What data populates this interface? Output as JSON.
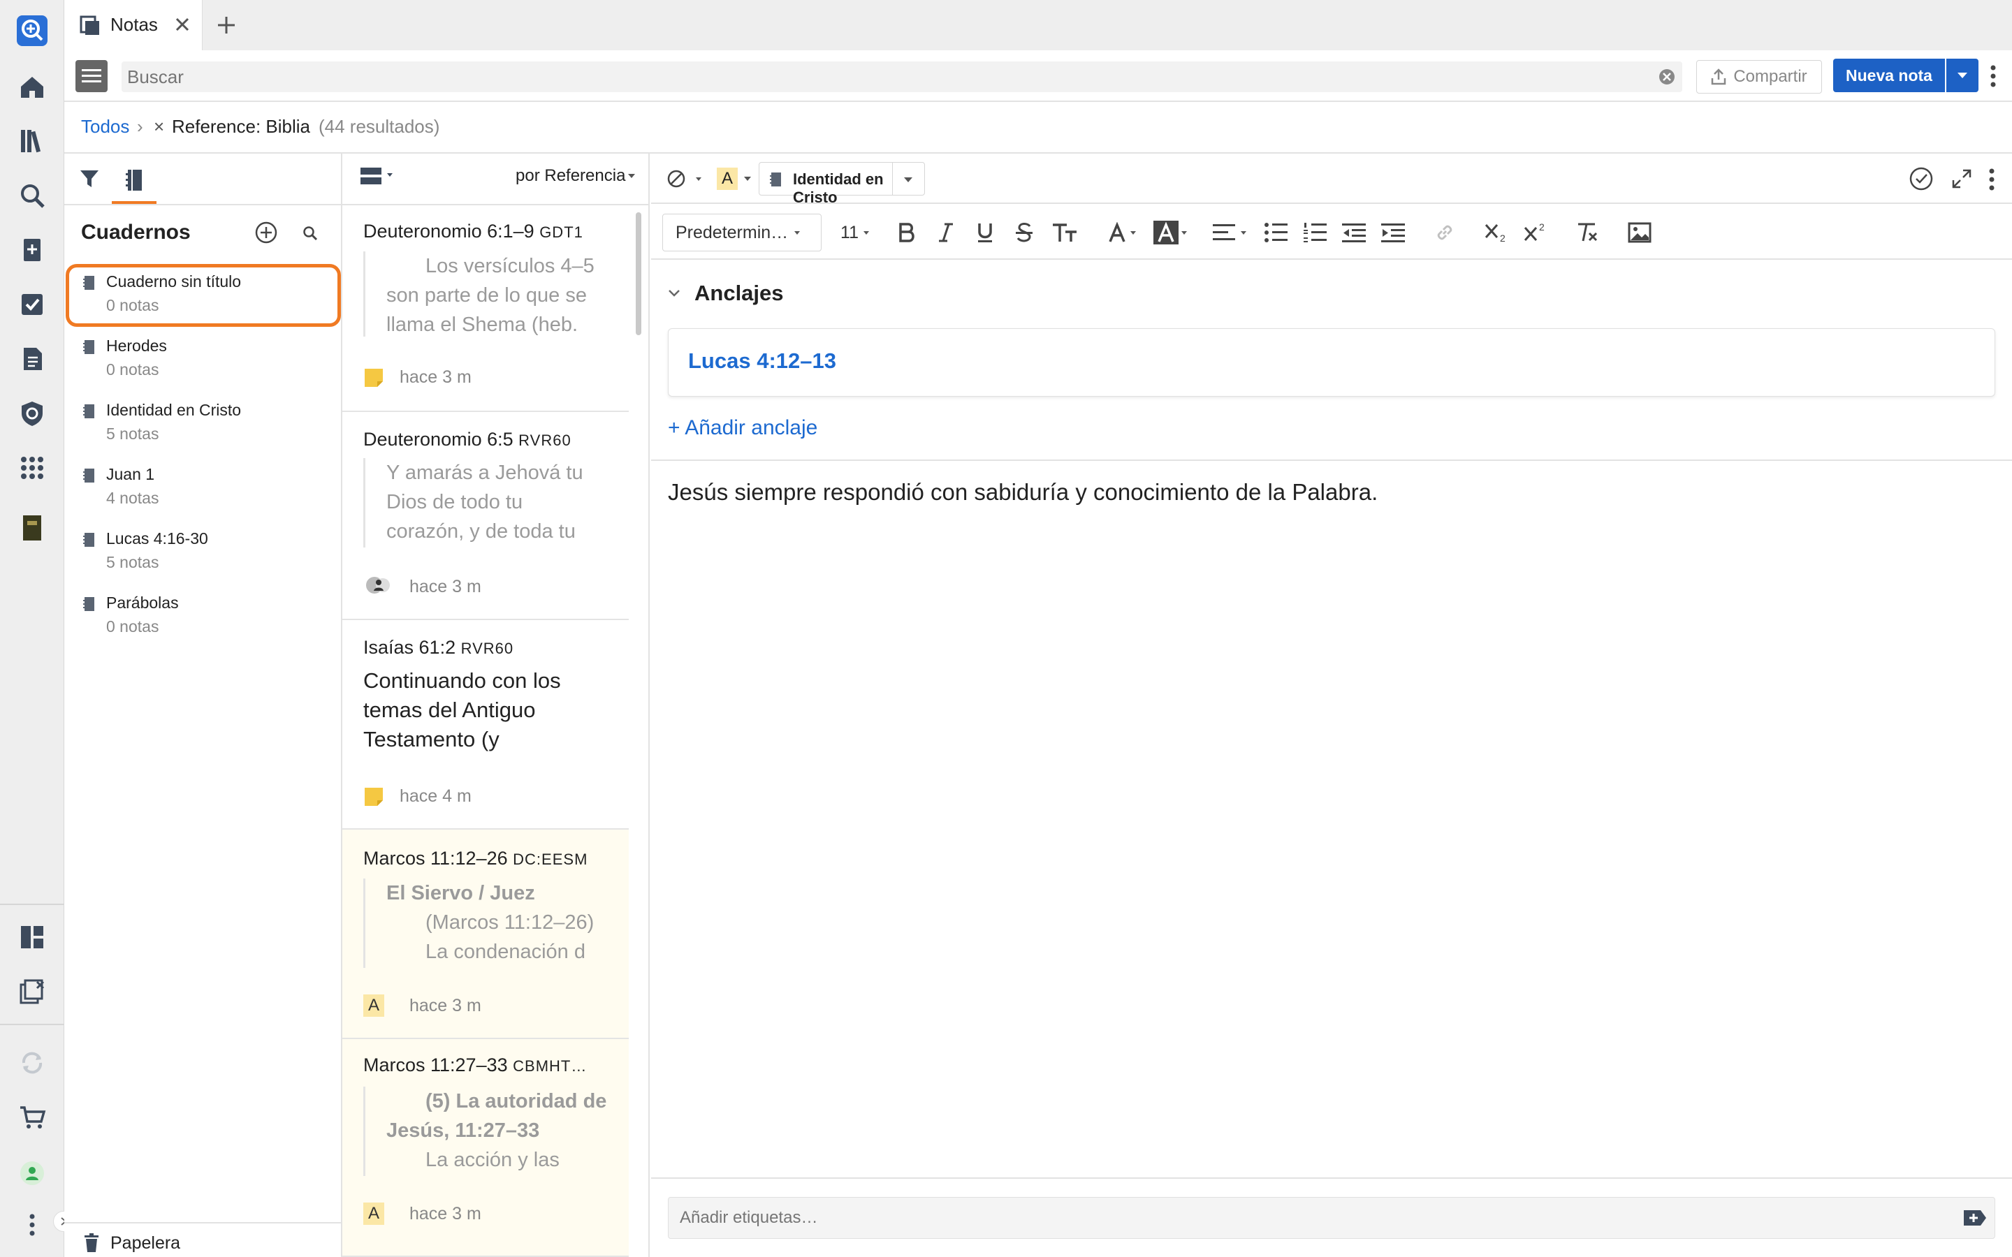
{
  "tab": {
    "title": "Notas"
  },
  "toolbar": {
    "search_placeholder": "Buscar",
    "share_label": "Compartir",
    "new_note_label": "Nueva nota"
  },
  "breadcrumb": {
    "all": "Todos",
    "filter": "Reference: Biblia",
    "results": "(44 resultados)"
  },
  "notebooks": {
    "title": "Cuadernos",
    "items": [
      {
        "name": "Cuaderno sin título",
        "count": "0 notas"
      },
      {
        "name": "Herodes",
        "count": "0 notas"
      },
      {
        "name": "Identidad en Cristo",
        "count": "5 notas"
      },
      {
        "name": "Juan 1",
        "count": "4 notas"
      },
      {
        "name": "Lucas 4:16-30",
        "count": "5 notas"
      },
      {
        "name": "Parábolas",
        "count": "0 notas"
      }
    ],
    "trash_label": "Papelera"
  },
  "notelist": {
    "sort_label": "por Referencia",
    "cards": [
      {
        "ref": "Deuteronomio 6:1–9",
        "version": "GDT1",
        "excerpt": [
          "Los versículos 4–5",
          "son parte de lo que se",
          "llama el Shema (heb."
        ],
        "time": "hace 3 m"
      },
      {
        "ref": "Deuteronomio 6:5",
        "version": "RVR60",
        "excerpt": [
          "Y amarás a Jehová tu",
          "Dios de todo tu",
          "corazón, y de toda tu"
        ],
        "time": "hace 3 m"
      },
      {
        "ref": "Isaías 61:2",
        "version": "RVR60",
        "text": [
          "Continuando con los",
          "temas del Antiguo",
          "Testamento (y"
        ],
        "time": "hace 4 m"
      },
      {
        "ref": "Marcos 11:12–26",
        "version": "DC:EESM",
        "heading": "El Siervo / Juez",
        "excerpt": [
          "(Marcos 11:12–26)",
          "La condenación d"
        ],
        "time": "hace 3 m",
        "badge": "A"
      },
      {
        "ref": "Marcos 11:27–33",
        "version": "CBMHT…",
        "heading": "(5) La autoridad de Jesús, 11:27–33",
        "excerpt": [
          "La acción y las"
        ],
        "time": "hace 3 m",
        "badge": "A"
      }
    ]
  },
  "editor": {
    "notebook_label": "Identidad en Cristo",
    "highlight_badge": "A",
    "style_select": "Predetermin…",
    "font_size": "11",
    "anchors_title": "Anclajes",
    "anchor_ref": "Lucas 4:12–13",
    "add_anchor": "+ Añadir anclaje",
    "body": "Jesús siempre respondió con sabiduría y conocimiento de la Palabra.",
    "tags_placeholder": "Añadir etiquetas…"
  },
  "colors": {
    "accent": "#1d61c5",
    "link": "#1d6ad0",
    "highlight_orange": "#f07a23",
    "sticky_yellow": "#f5c842",
    "badge_bg": "#fbe7a6"
  }
}
